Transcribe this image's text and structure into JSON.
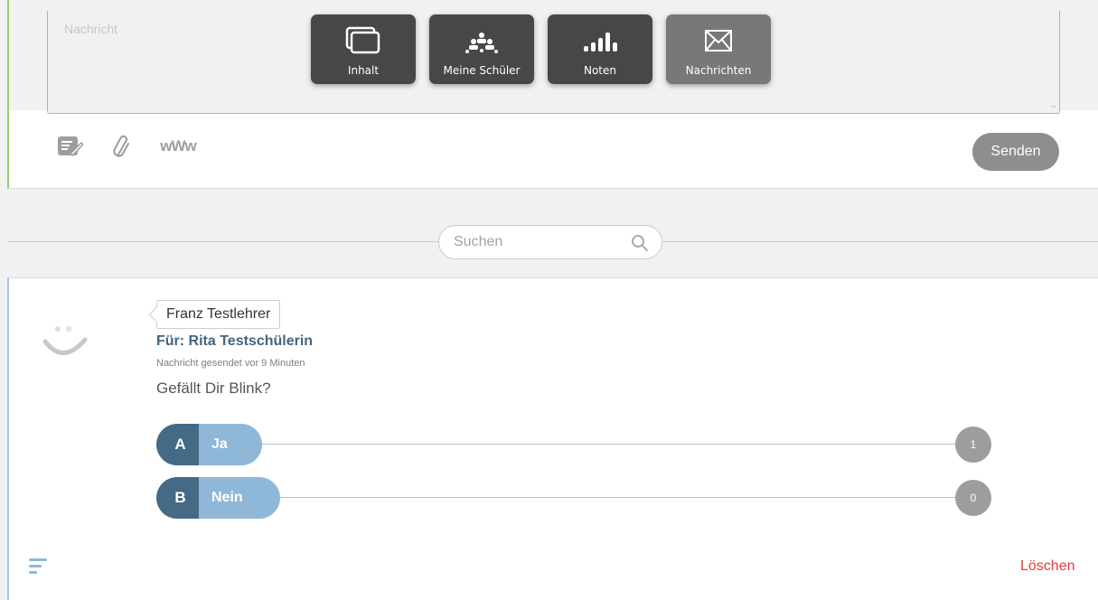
{
  "nav": {
    "items": [
      {
        "label": "Inhalt",
        "icon": "content-icon",
        "active": false
      },
      {
        "label": "Meine Schüler",
        "icon": "students-icon",
        "active": false
      },
      {
        "label": "Noten",
        "icon": "grades-icon",
        "active": false
      },
      {
        "label": "Nachrichten",
        "icon": "envelope-icon",
        "active": true
      }
    ]
  },
  "compose": {
    "placeholder": "Nachricht",
    "value": "",
    "tools": [
      "note-icon",
      "paperclip-icon",
      "www-icon"
    ],
    "www_label": "wWw",
    "send_label": "Senden"
  },
  "search": {
    "placeholder": "Suchen"
  },
  "message": {
    "sender": "Franz Testlehrer",
    "recipient": "Für: Rita Testschülerin",
    "sent_at": "Nachricht gesendet vor 9 Minuten",
    "question": "Gefällt Dir Blink?",
    "options": [
      {
        "letter": "A",
        "label": "Ja",
        "count": "1"
      },
      {
        "letter": "B",
        "label": "Nein",
        "count": "0"
      }
    ],
    "delete_label": "Löschen"
  },
  "colors": {
    "accent_green": "#8fcf6a",
    "option_dark": "#456a86",
    "option_light": "#8fb8d8",
    "delete_red": "#e23a3a",
    "nav_dark": "#474747"
  }
}
